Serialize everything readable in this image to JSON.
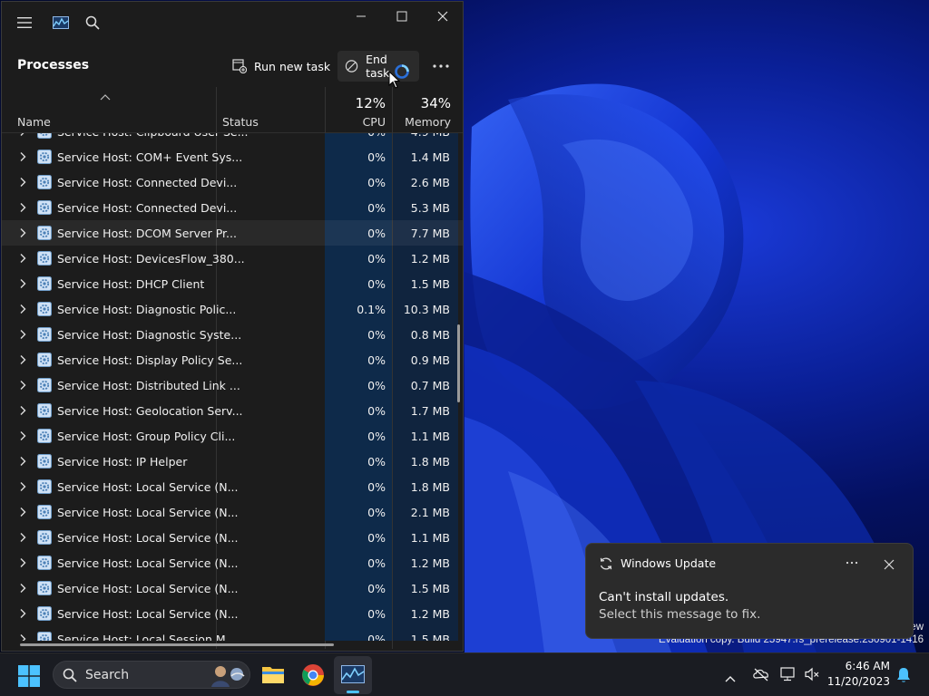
{
  "window": {
    "title_icon": "task-manager-chart-icon",
    "page_title": "Processes",
    "run_new_task": "Run new task",
    "end_task": "End task"
  },
  "columns": {
    "name": "Name",
    "status": "Status",
    "cpu_pct": "12%",
    "cpu": "CPU",
    "memory_pct": "34%",
    "memory": "Memory"
  },
  "partial_top": {
    "name": "Service Host: Clipboard User Se...",
    "cpu": "0%",
    "mem": "4.9 MB"
  },
  "processes": [
    {
      "name": "Service Host: COM+ Event Sys...",
      "cpu": "0%",
      "mem": "1.4 MB"
    },
    {
      "name": "Service Host: Connected Devi...",
      "cpu": "0%",
      "mem": "2.6 MB"
    },
    {
      "name": "Service Host: Connected Devi...",
      "cpu": "0%",
      "mem": "5.3 MB"
    },
    {
      "name": "Service Host: DCOM Server Pr...",
      "cpu": "0%",
      "mem": "7.7 MB"
    },
    {
      "name": "Service Host: DevicesFlow_380...",
      "cpu": "0%",
      "mem": "1.2 MB"
    },
    {
      "name": "Service Host: DHCP Client",
      "cpu": "0%",
      "mem": "1.5 MB"
    },
    {
      "name": "Service Host: Diagnostic Polic...",
      "cpu": "0.1%",
      "mem": "10.3 MB"
    },
    {
      "name": "Service Host: Diagnostic Syste...",
      "cpu": "0%",
      "mem": "0.8 MB"
    },
    {
      "name": "Service Host: Display Policy Se...",
      "cpu": "0%",
      "mem": "0.9 MB"
    },
    {
      "name": "Service Host: Distributed Link ...",
      "cpu": "0%",
      "mem": "0.7 MB"
    },
    {
      "name": "Service Host: Geolocation Serv...",
      "cpu": "0%",
      "mem": "1.7 MB"
    },
    {
      "name": "Service Host: Group Policy Cli...",
      "cpu": "0%",
      "mem": "1.1 MB"
    },
    {
      "name": "Service Host: IP Helper",
      "cpu": "0%",
      "mem": "1.8 MB"
    },
    {
      "name": "Service Host: Local Service (N...",
      "cpu": "0%",
      "mem": "1.8 MB"
    },
    {
      "name": "Service Host: Local Service (N...",
      "cpu": "0%",
      "mem": "2.1 MB"
    },
    {
      "name": "Service Host: Local Service (N...",
      "cpu": "0%",
      "mem": "1.1 MB"
    },
    {
      "name": "Service Host: Local Service (N...",
      "cpu": "0%",
      "mem": "1.2 MB"
    },
    {
      "name": "Service Host: Local Service (N...",
      "cpu": "0%",
      "mem": "1.5 MB"
    },
    {
      "name": "Service Host: Local Service (N...",
      "cpu": "0%",
      "mem": "1.2 MB"
    }
  ],
  "partial_bottom": {
    "name": "Service Host: Local Session M...",
    "cpu": "0%",
    "mem": "1.5 MB"
  },
  "notification": {
    "app": "Windows Update",
    "title": "Can't install updates.",
    "body": "Select this message to fix."
  },
  "desktop": {
    "watermark_partial": "ew",
    "watermark": "Evaluation copy. Build 25947.rs_prerelease.230901-1416"
  },
  "taskbar": {
    "search_label": "Search",
    "time": "6:46 AM",
    "date": "11/20/2023"
  },
  "colors": {
    "accent": "#4cc2ff",
    "window_bg": "#1c1c1c",
    "cpu_heat": "#0e2a4a"
  }
}
